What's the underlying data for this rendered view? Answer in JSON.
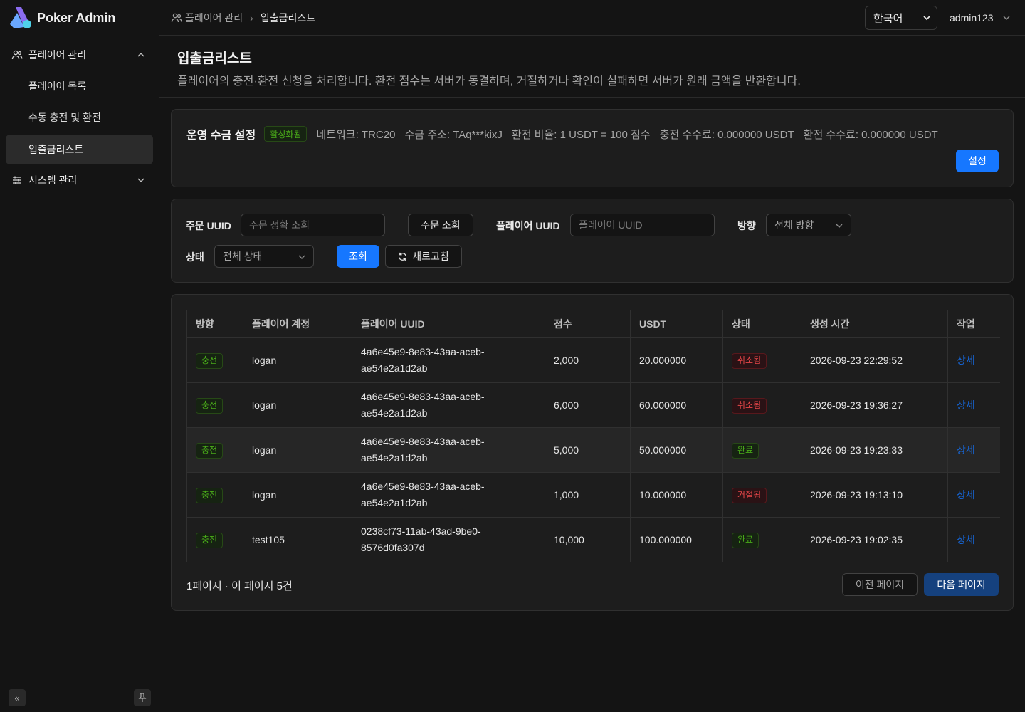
{
  "app": {
    "title": "Poker Admin"
  },
  "sidebar": {
    "groups": [
      {
        "label": "플레이어 관리",
        "items": [
          "플레이어 목록",
          "수동 충전 및 환전",
          "입출금리스트"
        ]
      },
      {
        "label": "시스템 관리"
      }
    ],
    "active_item": "입출금리스트",
    "collapse_icon": "«",
    "pin_icon": "pin-icon"
  },
  "header": {
    "breadcrumb": {
      "parent": "플레이어 관리",
      "current": "입출금리스트"
    },
    "language": "한국어",
    "user": "admin123"
  },
  "page": {
    "title": "입출금리스트",
    "description": "플레이어의 충전·환전 신청을 처리합니다. 환전 점수는 서버가 동결하며, 거절하거나 확인이 실패하면 서버가 원래 금액을 반환합니다."
  },
  "settlement": {
    "title": "운영 수금 설정",
    "status": "활성화됨",
    "network": "네트워크: TRC20",
    "address": "수금 주소: TAq***kixJ",
    "rate": "환전 비율: 1 USDT = 100 점수",
    "deposit_fee": "충전 수수료: 0.000000 USDT",
    "withdraw_fee": "환전 수수료: 0.000000 USDT",
    "button": "설정"
  },
  "filters": {
    "order_uuid_label": "주문 UUID",
    "order_uuid_placeholder": "주문 정확 조회",
    "order_search_button": "주문 조회",
    "player_uuid_label": "플레이어 UUID",
    "player_uuid_placeholder": "플레이어 UUID",
    "direction_label": "방향",
    "direction_value": "전체 방향",
    "status_label": "상태",
    "status_value": "전체 상태",
    "search_button": "조회",
    "refresh_button": "새로고침"
  },
  "table": {
    "columns": [
      "방향",
      "플레이어 계정",
      "플레이어 UUID",
      "점수",
      "USDT",
      "상태",
      "생성 시간",
      "작업"
    ],
    "rows": [
      {
        "direction": "충전",
        "account": "logan",
        "uuid_1": "4a6e45e9-8e83-43aa-aceb-",
        "uuid_2": "ae54e2a1d2ab",
        "score": "2,000",
        "usdt": "20.000000",
        "status": "취소됨",
        "status_color": "#e84749",
        "created": "2026-09-23 22:29:52",
        "action": "상세"
      },
      {
        "direction": "충전",
        "account": "logan",
        "uuid_1": "4a6e45e9-8e83-43aa-aceb-",
        "uuid_2": "ae54e2a1d2ab",
        "score": "6,000",
        "usdt": "60.000000",
        "status": "취소됨",
        "status_color": "#e84749",
        "created": "2026-09-23 19:36:27",
        "action": "상세"
      },
      {
        "direction": "충전",
        "account": "logan",
        "uuid_1": "4a6e45e9-8e83-43aa-aceb-",
        "uuid_2": "ae54e2a1d2ab",
        "score": "5,000",
        "usdt": "50.000000",
        "status": "완료",
        "status_color": "#49aa19",
        "created": "2026-09-23 19:23:33",
        "action": "상세"
      },
      {
        "direction": "충전",
        "account": "logan",
        "uuid_1": "4a6e45e9-8e83-43aa-aceb-",
        "uuid_2": "ae54e2a1d2ab",
        "score": "1,000",
        "usdt": "10.000000",
        "status": "거절됨",
        "status_color": "#e84749",
        "created": "2026-09-23 19:13:10",
        "action": "상세"
      },
      {
        "direction": "충전",
        "account": "test105",
        "uuid_1": "0238cf73-11ab-43ad-9be0-",
        "uuid_2": "8576d0fa307d",
        "score": "10,000",
        "usdt": "100.000000",
        "status": "완료",
        "status_color": "#49aa19",
        "created": "2026-09-23 19:02:35",
        "action": "상세"
      }
    ]
  },
  "pagination": {
    "info": "1페이지 · 이 페이지 5건",
    "prev": "이전 페이지",
    "next": "다음 페이지"
  },
  "colors": {
    "primary": "#1677ff",
    "success": "#49aa19",
    "danger": "#e84749",
    "background": "#141414",
    "card": "#1d1d1d"
  }
}
